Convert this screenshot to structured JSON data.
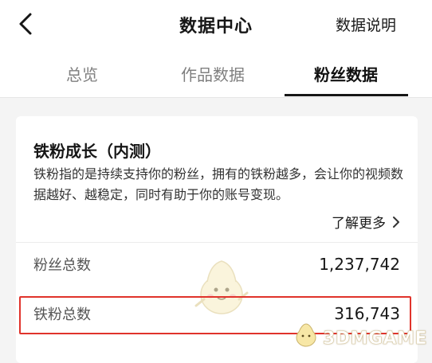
{
  "nav": {
    "title": "数据中心",
    "help": "数据说明"
  },
  "tabs": [
    {
      "label": "总览",
      "active": false
    },
    {
      "label": "作品数据",
      "active": false
    },
    {
      "label": "粉丝数据",
      "active": true
    }
  ],
  "card": {
    "title": "铁粉成长（内测）",
    "description": "铁粉指的是持续支持你的粉丝，拥有的铁粉越多，会让你的视频数据越好、越稳定，同时有助于你的账号变现。",
    "learn_more": "了解更多",
    "rows": [
      {
        "label": "粉丝总数",
        "value": "1,237,742"
      },
      {
        "label": "铁粉总数",
        "value": "316,743"
      }
    ]
  },
  "watermark": {
    "text": "3DMGAME",
    "icon": "mascot-icon"
  },
  "colors": {
    "highlight": "#e0332b",
    "active_tab": "#161616",
    "inactive_tab": "#7f7f7f"
  }
}
